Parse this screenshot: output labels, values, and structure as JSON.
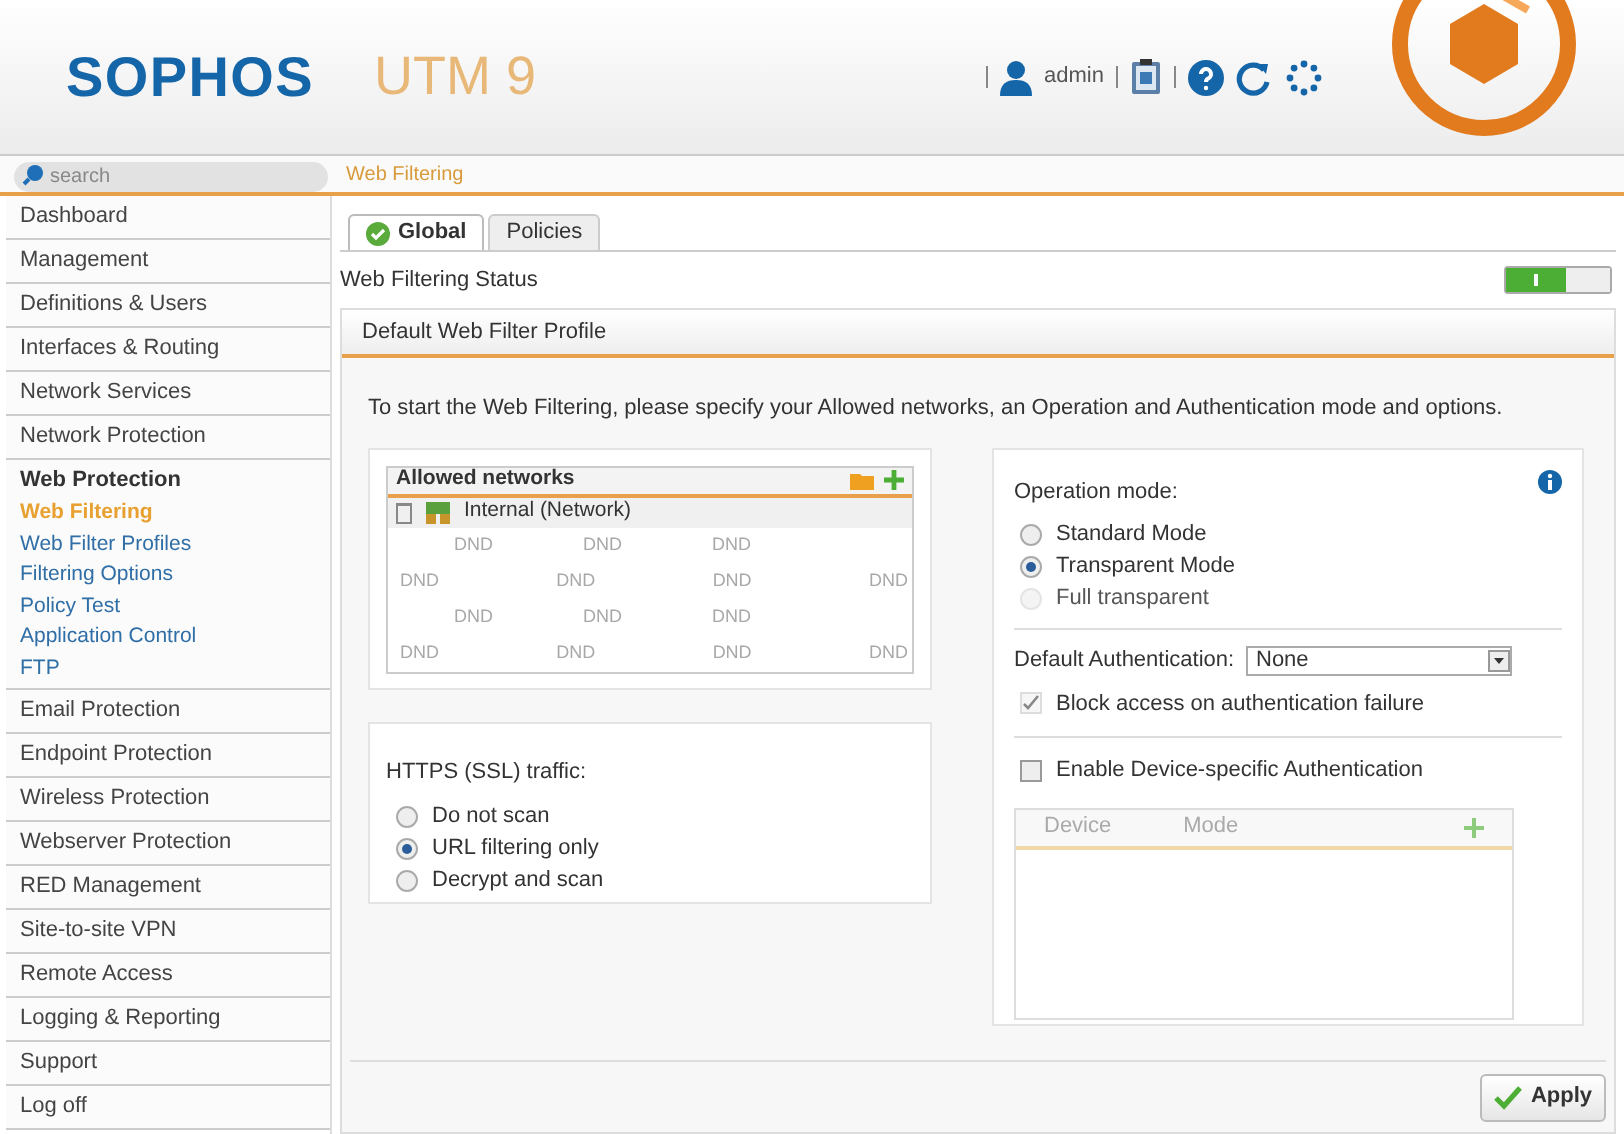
{
  "header": {
    "brand": "SOPHOS",
    "product": "UTM 9",
    "user": "admin"
  },
  "search": {
    "placeholder": "search"
  },
  "breadcrumb": "Web Filtering",
  "sidebar": {
    "items": [
      {
        "label": "Dashboard",
        "expanded": false
      },
      {
        "label": "Management",
        "expanded": false
      },
      {
        "label": "Definitions & Users",
        "expanded": false
      },
      {
        "label": "Interfaces & Routing",
        "expanded": false
      },
      {
        "label": "Network Services",
        "expanded": false
      },
      {
        "label": "Network Protection",
        "expanded": false
      },
      {
        "label": "Web Protection",
        "expanded": true,
        "children": [
          {
            "label": "Web Filtering",
            "selected": true
          },
          {
            "label": "Web Filter Profiles",
            "selected": false
          },
          {
            "label": "Filtering Options",
            "selected": false
          },
          {
            "label": "Policy Test",
            "selected": false
          },
          {
            "label": "Application Control",
            "selected": false
          },
          {
            "label": "FTP",
            "selected": false
          }
        ]
      },
      {
        "label": "Email Protection",
        "expanded": false
      },
      {
        "label": "Endpoint Protection",
        "expanded": false
      },
      {
        "label": "Wireless Protection",
        "expanded": false
      },
      {
        "label": "Webserver Protection",
        "expanded": false
      },
      {
        "label": "RED Management",
        "expanded": false
      },
      {
        "label": "Site-to-site VPN",
        "expanded": false
      },
      {
        "label": "Remote Access",
        "expanded": false
      },
      {
        "label": "Logging & Reporting",
        "expanded": false
      },
      {
        "label": "Support",
        "expanded": false
      },
      {
        "label": "Log off",
        "expanded": false
      }
    ]
  },
  "tabs": [
    {
      "label": "Global",
      "selected": true
    },
    {
      "label": "Policies",
      "selected": false
    }
  ],
  "status": {
    "label": "Web Filtering Status",
    "on": true
  },
  "panel": {
    "title": "Default Web Filter Profile",
    "intro": "To start the Web Filtering, please specify your Allowed networks, an Operation and Authentication mode and options.",
    "allowed_networks": {
      "title": "Allowed networks",
      "items": [
        "Internal (Network)"
      ],
      "drop_marks": [
        [
          "DND",
          "DND",
          "DND"
        ],
        [
          "DND",
          "DND",
          "DND",
          "DND"
        ],
        [
          "DND",
          "DND",
          "DND"
        ],
        [
          "DND",
          "DND",
          "DND",
          "DND"
        ]
      ]
    },
    "https": {
      "label": "HTTPS (SSL) traffic:",
      "options": [
        {
          "label": "Do not scan",
          "selected": false
        },
        {
          "label": "URL filtering only",
          "selected": true
        },
        {
          "label": "Decrypt and scan",
          "selected": false
        }
      ]
    },
    "operation_mode": {
      "label": "Operation mode:",
      "options": [
        {
          "label": "Standard Mode",
          "selected": false,
          "disabled": false
        },
        {
          "label": "Transparent Mode",
          "selected": true,
          "disabled": false
        },
        {
          "label": "Full transparent",
          "selected": false,
          "disabled": true
        }
      ]
    },
    "authentication": {
      "label": "Default Authentication:",
      "value": "None"
    },
    "block_access": {
      "label": "Block access on authentication failure",
      "checked": true,
      "disabled": true
    },
    "device_auth": {
      "label": "Enable Device-specific Authentication",
      "checked": false
    },
    "device_table": {
      "columns": [
        "Device",
        "Mode"
      ]
    }
  },
  "apply_button": "Apply"
}
